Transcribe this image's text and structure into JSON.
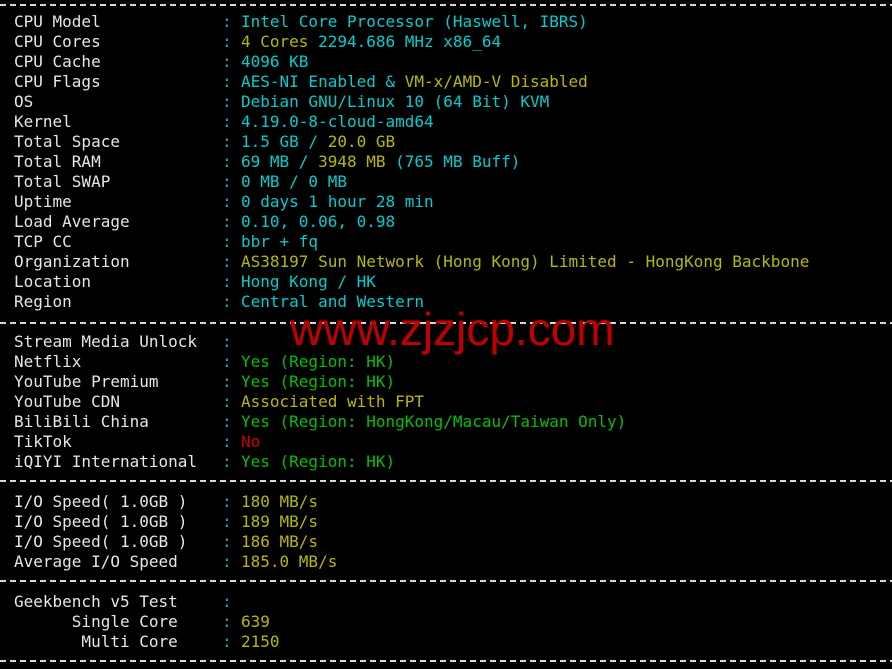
{
  "terminal": {
    "background": "#000000",
    "font_size_px": 16,
    "line_height_px": 20,
    "colors": {
      "label": "#e6e6e6",
      "colon": "#2fa8c9",
      "cyan": "#00cdcd",
      "yellow": "#b8b800",
      "green": "#00c000",
      "red": "#cc0000",
      "rule": "#d8d8d8"
    }
  },
  "watermark": {
    "text": "www.zjzjcp.com",
    "color": "#c00000"
  },
  "separator": {
    "char": "-",
    "style": "dashed"
  },
  "sections": [
    {
      "name": "system-info",
      "rows": [
        {
          "label": "CPU Model",
          "colon": ":",
          "parts": [
            {
              "text": "Intel Core Processor (Haswell, IBRS)",
              "color": "cyan"
            }
          ]
        },
        {
          "label": "CPU Cores",
          "colon": ":",
          "parts": [
            {
              "text": "4 Cores ",
              "color": "yellow"
            },
            {
              "text": "2294.686 MHz x86_64",
              "color": "cyan"
            }
          ]
        },
        {
          "label": "CPU Cache",
          "colon": ":",
          "parts": [
            {
              "text": "4096 KB",
              "color": "cyan"
            }
          ]
        },
        {
          "label": "CPU Flags",
          "colon": ":",
          "parts": [
            {
              "text": "AES-NI Enabled & ",
              "color": "cyan"
            },
            {
              "text": "VM-x/AMD-V Disabled",
              "color": "yellow"
            }
          ]
        },
        {
          "label": "OS",
          "colon": ":",
          "parts": [
            {
              "text": "Debian GNU/Linux 10 (64 Bit) KVM",
              "color": "cyan"
            }
          ]
        },
        {
          "label": "Kernel",
          "colon": ":",
          "parts": [
            {
              "text": "4.19.0-8-cloud-amd64",
              "color": "cyan"
            }
          ]
        },
        {
          "label": "Total Space",
          "colon": ":",
          "parts": [
            {
              "text": "1.5 GB / ",
              "color": "cyan"
            },
            {
              "text": "20.0 GB",
              "color": "yellow"
            }
          ]
        },
        {
          "label": "Total RAM",
          "colon": ":",
          "parts": [
            {
              "text": "69 MB / ",
              "color": "cyan"
            },
            {
              "text": "3948 MB ",
              "color": "yellow"
            },
            {
              "text": "(765 MB Buff)",
              "color": "cyan"
            }
          ]
        },
        {
          "label": "Total SWAP",
          "colon": ":",
          "parts": [
            {
              "text": "0 MB / 0 MB",
              "color": "cyan"
            }
          ]
        },
        {
          "label": "Uptime",
          "colon": ":",
          "parts": [
            {
              "text": "0 days 1 hour 28 min",
              "color": "cyan"
            }
          ]
        },
        {
          "label": "Load Average",
          "colon": ":",
          "parts": [
            {
              "text": "0.10, 0.06, 0.98",
              "color": "cyan"
            }
          ]
        },
        {
          "label": "TCP CC",
          "colon": ":",
          "parts": [
            {
              "text": "bbr + fq",
              "color": "cyan"
            }
          ]
        },
        {
          "label": "Organization",
          "colon": ":",
          "parts": [
            {
              "text": "AS38197 Sun Network (Hong Kong) Limited - HongKong Backbone",
              "color": "yellow"
            }
          ]
        },
        {
          "label": "Location",
          "colon": ":",
          "parts": [
            {
              "text": "Hong Kong / HK",
              "color": "cyan"
            }
          ]
        },
        {
          "label": "Region",
          "colon": ":",
          "parts": [
            {
              "text": "Central and Western",
              "color": "cyan"
            }
          ]
        }
      ]
    },
    {
      "name": "stream-media-unlock",
      "rows": [
        {
          "label": "Stream Media Unlock",
          "colon": ":",
          "parts": []
        },
        {
          "label": "Netflix",
          "colon": ":",
          "parts": [
            {
              "text": "Yes (Region: HK)",
              "color": "green"
            }
          ]
        },
        {
          "label": "YouTube Premium",
          "colon": ":",
          "parts": [
            {
              "text": "Yes (Region: HK)",
              "color": "green"
            }
          ]
        },
        {
          "label": "YouTube CDN",
          "colon": ":",
          "parts": [
            {
              "text": "Associated with FPT",
              "color": "yellow"
            }
          ]
        },
        {
          "label": "BiliBili China",
          "colon": ":",
          "parts": [
            {
              "text": "Yes (Region: HongKong/Macau/Taiwan Only)",
              "color": "green"
            }
          ]
        },
        {
          "label": "TikTok",
          "colon": ":",
          "parts": [
            {
              "text": "No",
              "color": "red"
            }
          ]
        },
        {
          "label": "iQIYI International",
          "colon": ":",
          "parts": [
            {
              "text": "Yes (Region: HK)",
              "color": "green"
            }
          ]
        }
      ]
    },
    {
      "name": "io-speed",
      "rows": [
        {
          "label": "I/O Speed( 1.0GB )",
          "colon": ":",
          "parts": [
            {
              "text": "180 MB/s",
              "color": "yellow"
            }
          ]
        },
        {
          "label": "I/O Speed( 1.0GB )",
          "colon": ":",
          "parts": [
            {
              "text": "189 MB/s",
              "color": "yellow"
            }
          ]
        },
        {
          "label": "I/O Speed( 1.0GB )",
          "colon": ":",
          "parts": [
            {
              "text": "186 MB/s",
              "color": "yellow"
            }
          ]
        },
        {
          "label": "Average I/O Speed",
          "colon": ":",
          "parts": [
            {
              "text": "185.0 MB/s",
              "color": "yellow"
            }
          ]
        }
      ]
    },
    {
      "name": "geekbench",
      "rows": [
        {
          "label": "Geekbench v5 Test",
          "colon": ":",
          "parts": []
        },
        {
          "label": "      Single Core",
          "colon": ":",
          "parts": [
            {
              "text": "639",
              "color": "yellow"
            }
          ]
        },
        {
          "label": "       Multi Core",
          "colon": ":",
          "parts": [
            {
              "text": "2150",
              "color": "yellow"
            }
          ]
        }
      ]
    }
  ]
}
